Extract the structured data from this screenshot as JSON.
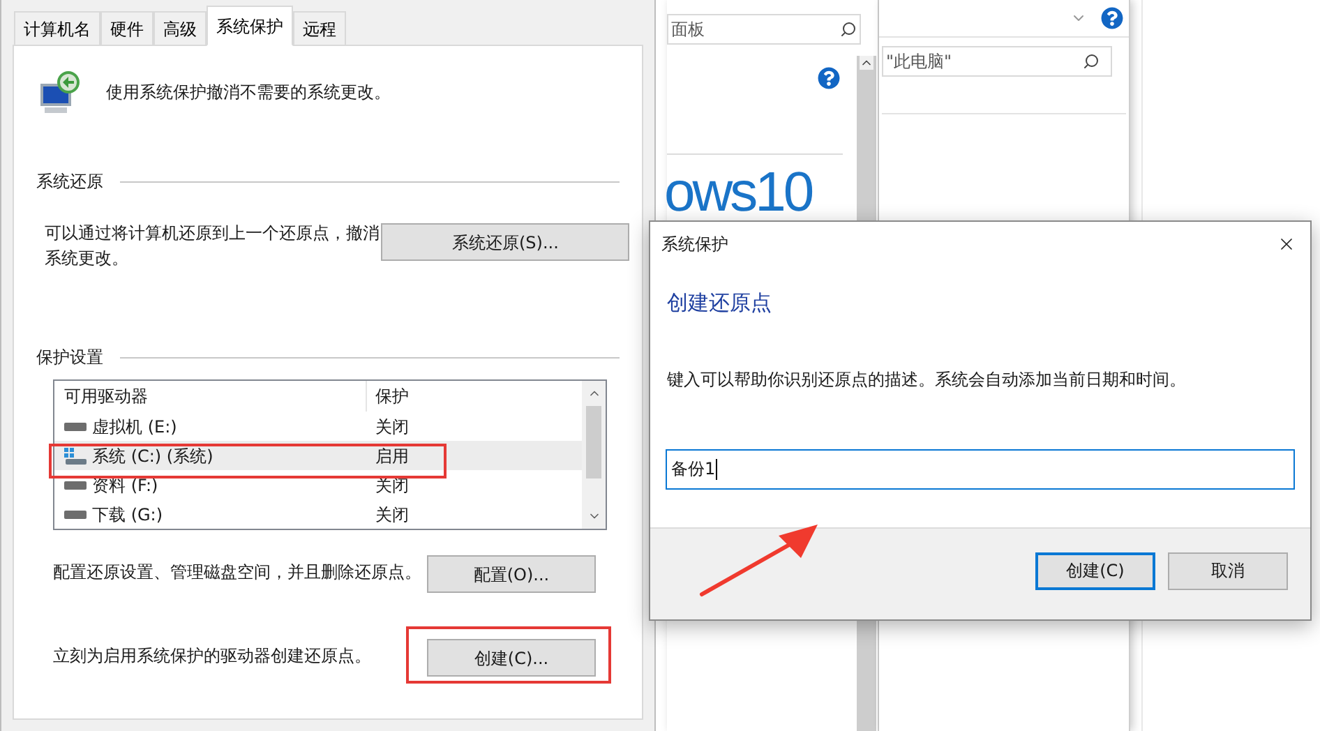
{
  "system_properties": {
    "tabs": [
      {
        "label": "计算机名",
        "selected": false
      },
      {
        "label": "硬件",
        "selected": false
      },
      {
        "label": "高级",
        "selected": false
      },
      {
        "label": "系统保护",
        "selected": true
      },
      {
        "label": "远程",
        "selected": false
      }
    ],
    "intro": "使用系统保护撤消不需要的系统更改。",
    "restore_section": {
      "title": "系统还原",
      "description": "可以通过将计算机还原到上一个还原点，撤消系统更改。",
      "button": "系统还原(S)..."
    },
    "protection_section": {
      "title": "保护设置",
      "columns": [
        "可用驱动器",
        "保护"
      ],
      "drives": [
        {
          "name": "虚拟机 (E:)",
          "protection": "关闭",
          "kind": "drive",
          "selected": false
        },
        {
          "name": "系统 (C:) (系统)",
          "protection": "启用",
          "kind": "system",
          "selected": true
        },
        {
          "name": "资料 (F:)",
          "protection": "关闭",
          "kind": "drive",
          "selected": false
        },
        {
          "name": "下载 (G:)",
          "protection": "关闭",
          "kind": "drive",
          "selected": false
        }
      ]
    },
    "configure": {
      "text": "配置还原设置、管理磁盘空间，并且删除还原点。",
      "button": "配置(O)..."
    },
    "create": {
      "text": "立刻为启用系统保护的驱动器创建还原点。",
      "button": "创建(C)..."
    }
  },
  "background_windows": [
    {
      "search_text": "面板",
      "logo_text": "ows10"
    },
    {
      "search_text": "\"此电脑\""
    }
  ],
  "create_dialog": {
    "title": "系统保护",
    "heading": "创建还原点",
    "description": "键入可以帮助你识别还原点的描述。系统会自动添加当前日期和时间。",
    "input_value": "备份1",
    "buttons": [
      {
        "label": "创建(C)",
        "default": true
      },
      {
        "label": "取消",
        "default": false
      }
    ]
  }
}
